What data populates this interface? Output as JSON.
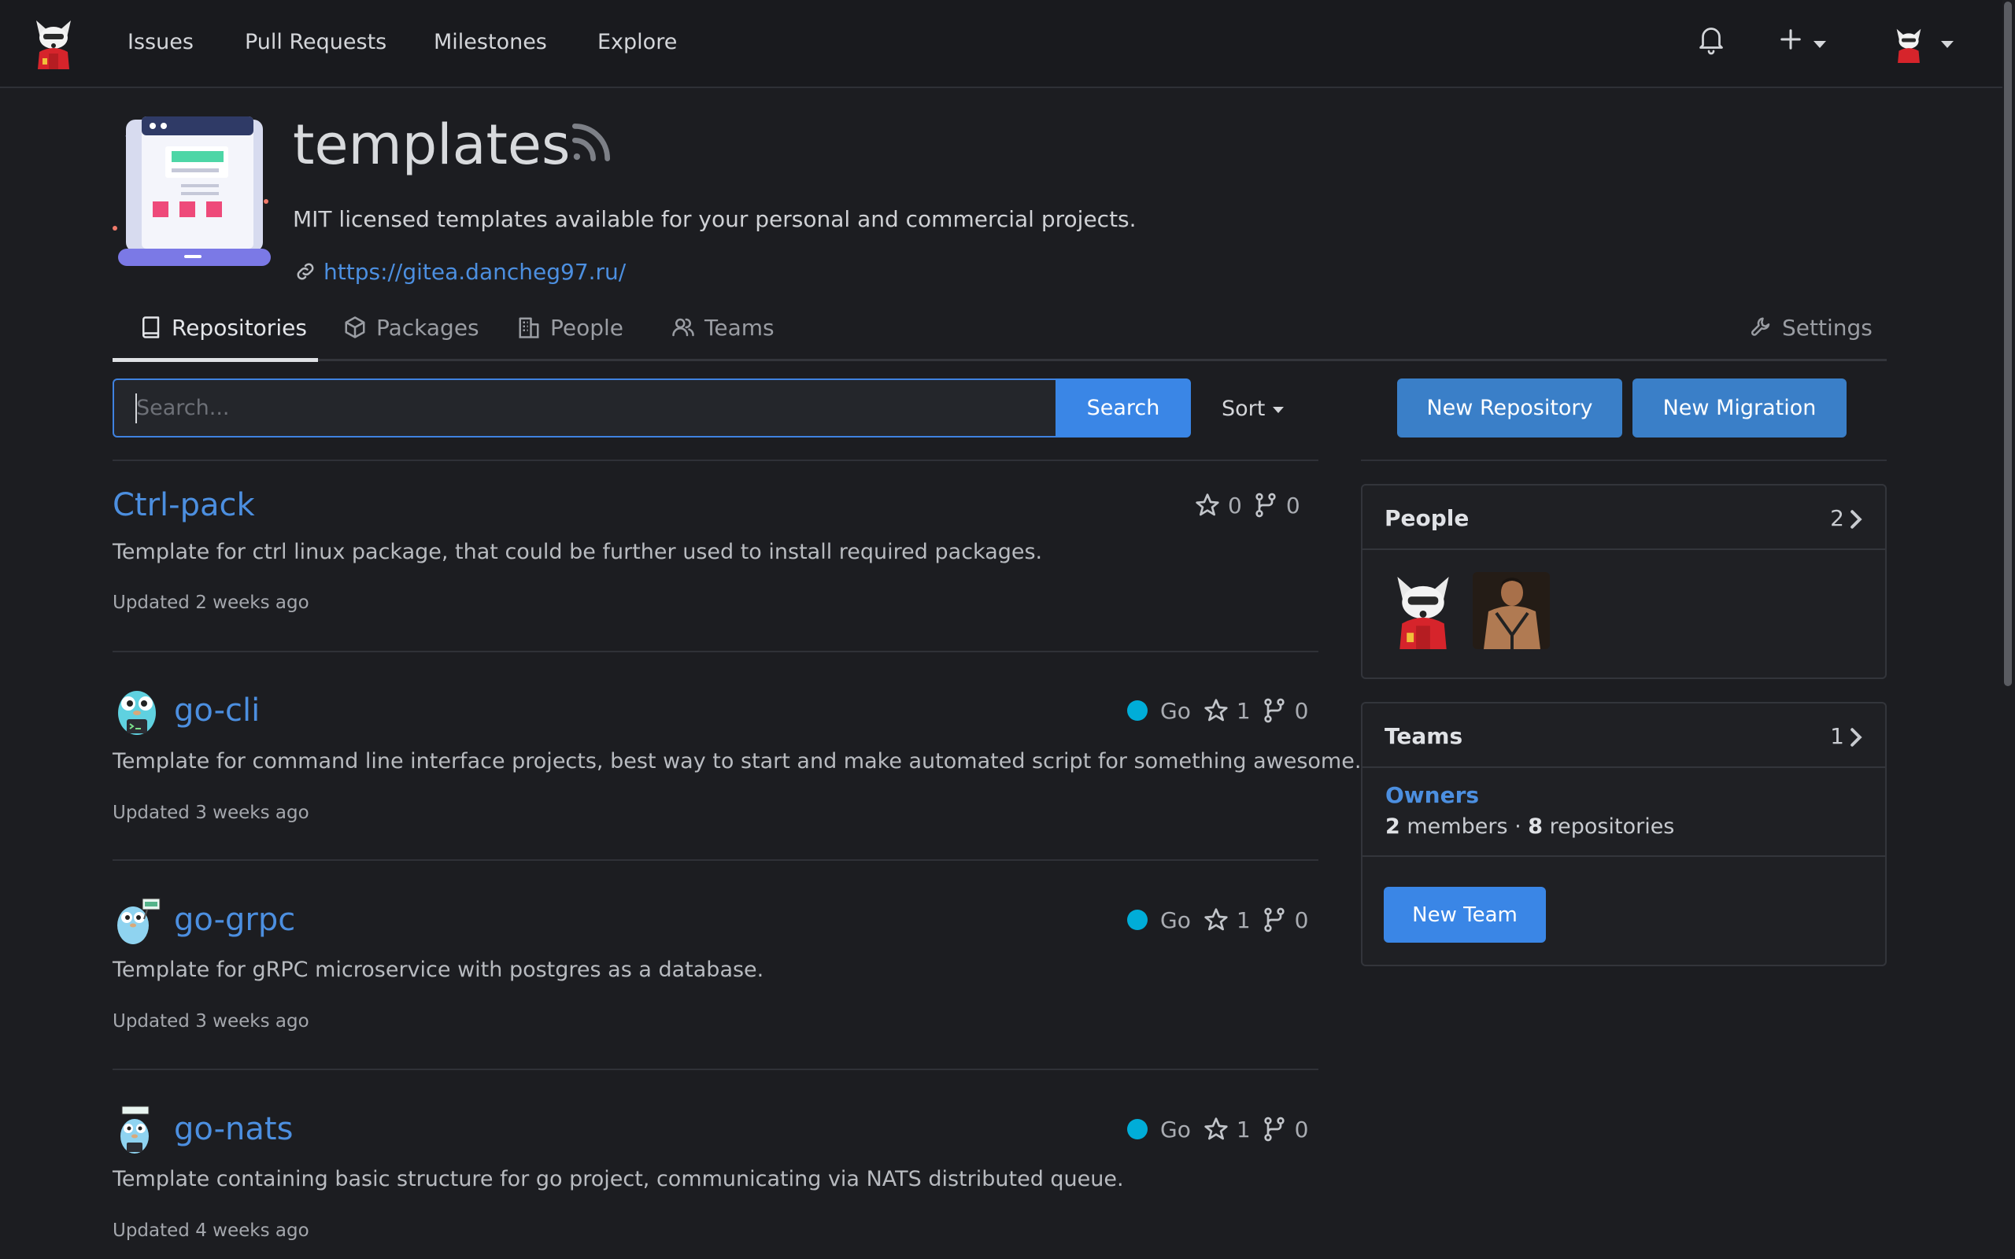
{
  "navbar": {
    "links": [
      "Issues",
      "Pull Requests",
      "Milestones",
      "Explore"
    ],
    "icons": [
      "bell-icon",
      "plus-icon",
      "avatar"
    ]
  },
  "org": {
    "name": "templates",
    "description": "MIT licensed templates available for your personal and commercial projects.",
    "website": "https://gitea.dancheg97.ru/"
  },
  "tabs": [
    {
      "label": "Repositories",
      "icon": "repo-icon",
      "active": true
    },
    {
      "label": "Packages",
      "icon": "package-icon",
      "active": false
    },
    {
      "label": "People",
      "icon": "organization-icon",
      "active": false
    },
    {
      "label": "Teams",
      "icon": "people-icon",
      "active": false
    },
    {
      "label": "Settings",
      "icon": "tools-icon",
      "active": false
    }
  ],
  "search": {
    "placeholder": "Search...",
    "value": "",
    "button_label": "Search",
    "sort_label": "Sort"
  },
  "actions": {
    "new_repository": "New Repository",
    "new_migration": "New Migration"
  },
  "repos": [
    {
      "name": "Ctrl-pack",
      "language": "",
      "stars": "0",
      "forks": "0",
      "description": "Template for ctrl linux package, that could be further used to install required packages.",
      "updated": "Updated 2 weeks ago"
    },
    {
      "name": "go-cli",
      "language": "Go",
      "stars": "1",
      "forks": "0",
      "description": "Template for command line interface projects, best way to start and make automated script for something awesome.",
      "updated": "Updated 3 weeks ago"
    },
    {
      "name": "go-grpc",
      "language": "Go",
      "stars": "1",
      "forks": "0",
      "description": "Template for gRPC microservice with postgres as a database.",
      "updated": "Updated 3 weeks ago"
    },
    {
      "name": "go-nats",
      "language": "Go",
      "stars": "1",
      "forks": "0",
      "description": "Template containing basic structure for go project, communicating via NATS distributed queue.",
      "updated": "Updated 4 weeks ago"
    }
  ],
  "sidebar": {
    "people": {
      "title": "People",
      "count": "2"
    },
    "teams": {
      "title": "Teams",
      "count": "1",
      "team_name": "Owners",
      "members_count": "2",
      "members_label": " members · ",
      "repos_count": "8",
      "repos_label": " repositories",
      "new_team_label": "New Team"
    }
  },
  "colors": {
    "accent": "#3a86e6",
    "link": "#4c8fe0",
    "go_language": "#00add8",
    "background": "#1c1d21"
  }
}
